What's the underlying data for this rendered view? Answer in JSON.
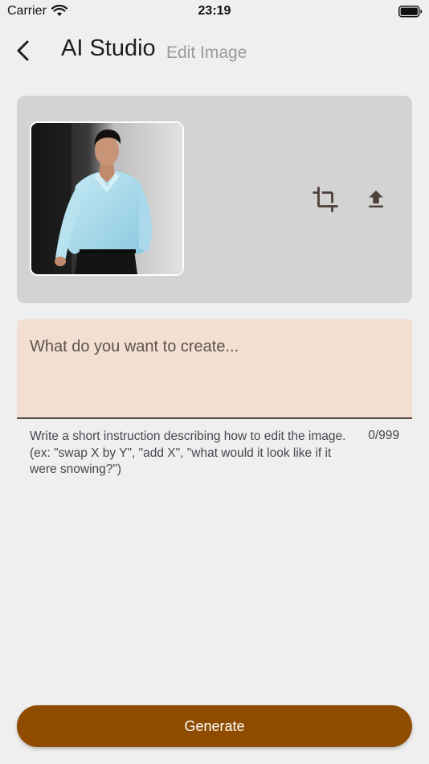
{
  "status_bar": {
    "carrier": "Carrier",
    "time": "23:19"
  },
  "header": {
    "title": "AI Studio",
    "subtitle": "Edit Image"
  },
  "image_card": {
    "icons": [
      "crop-icon",
      "upload-icon"
    ]
  },
  "prompt_field": {
    "placeholder": "What do you want to create...",
    "value": "",
    "helper": "Write a short instruction describing how to edit the image. (ex: \"swap X by Y\", \"add X\", \"what would it look like if it were snowing?\")",
    "counter": "0/999"
  },
  "actions": {
    "generate_label": "Generate"
  },
  "colors": {
    "background": "#efefef",
    "card": "#d3d3d3",
    "input": "#f2dfd2",
    "primary": "#8f4c00",
    "icon": "#4e3f3a"
  }
}
